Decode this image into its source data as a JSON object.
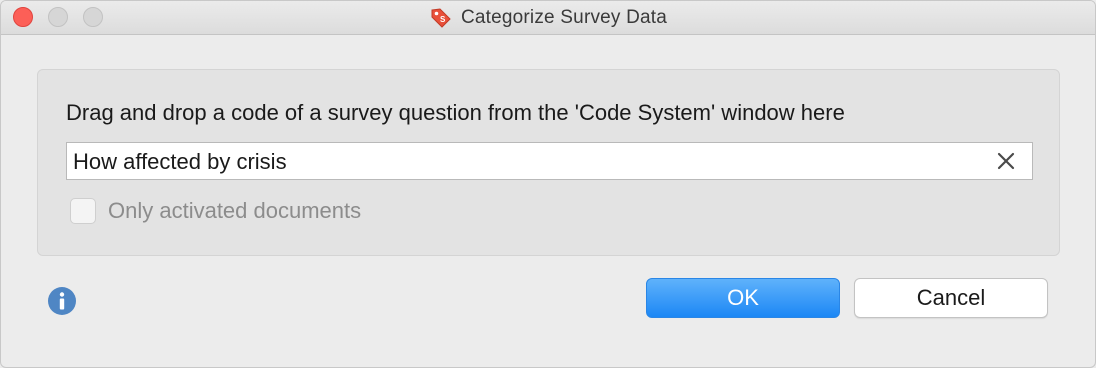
{
  "window": {
    "title": "Categorize Survey Data",
    "title_icon": "tag-icon",
    "accent_color": "#1c87f5"
  },
  "panel": {
    "instruction": "Drag and drop a code of a survey question from the 'Code System' window here",
    "field_value": "How affected by crisis",
    "clear_icon": "close-x-icon",
    "checkbox": {
      "label": "Only activated documents",
      "checked": false,
      "enabled": false
    }
  },
  "footer": {
    "info_icon": "info-icon",
    "ok_label": "OK",
    "cancel_label": "Cancel"
  }
}
